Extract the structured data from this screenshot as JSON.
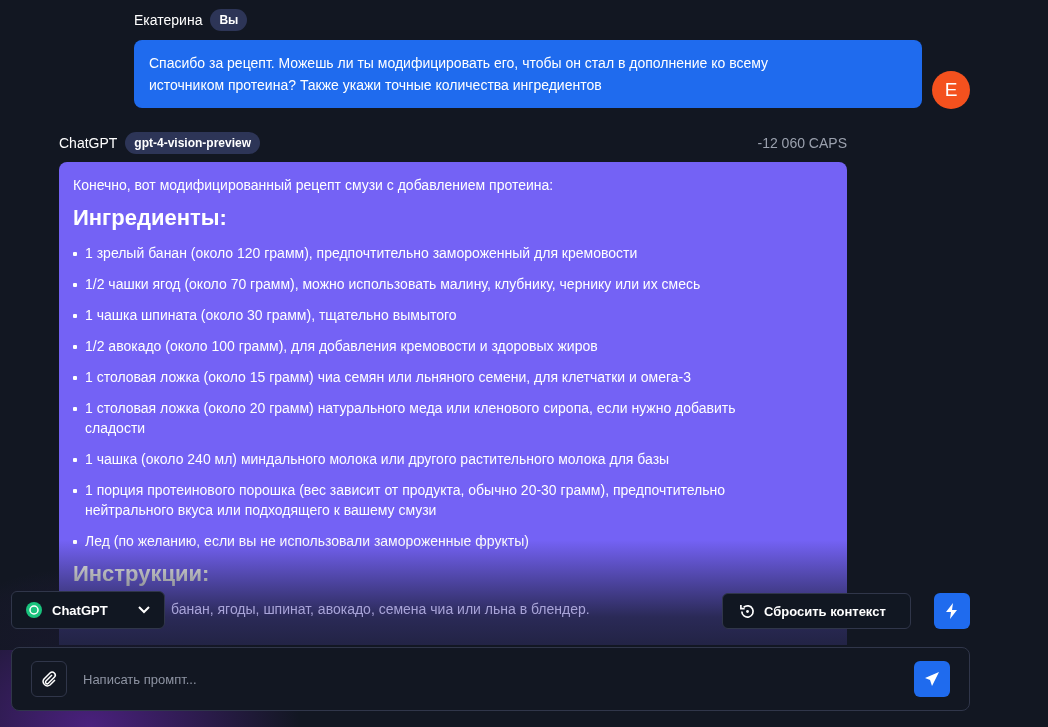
{
  "user_message": {
    "author": "Екатерина",
    "badge": "Вы",
    "text": "Спасибо за рецепт. Можешь ли ты модифицировать его, чтобы он стал в дополнение ко всему источником протеина? Также укажи точные количества ингредиентов",
    "avatar": "E"
  },
  "bot_message": {
    "author": "ChatGPT",
    "model": "gpt-4-vision-preview",
    "cost": "-12 060 CAPS",
    "intro": "Конечно, вот модифицированный рецепт смузи с добавлением протеина:",
    "ingredients_heading": "Ингредиенты:",
    "ingredients": [
      "1 зрелый банан (около 120 грамм), предпочтительно замороженный для кремовости",
      "1/2 чашки ягод (около 70 грамм), можно использовать малину, клубнику, чернику или их смесь",
      "1 чашка шпината (около 30 грамм), тщательно вымытого",
      "1/2 авокадо (около 100 грамм), для добавления кремовости и здоровых жиров",
      "1 столовая ложка (около 15 грамм) чиа семян или льняного семени, для клетчатки и омега-3",
      "1 столовая ложка (около 20 грамм) натурального меда или кленового сиропа, если нужно добавить сладости",
      "1 чашка (около 240 мл) миндального молока или другого растительного молока для базы",
      "1 порция протеинового порошка (вес зависит от продукта, обычно 20-30 грамм), предпочтительно нейтрального вкуса или подходящего к вашему смузи",
      "Лед (по желанию, если вы не использовали замороженные фрукты)"
    ],
    "instructions_heading": "Инструкции:",
    "instructions": [
      "банан, ягоды, шпинат, авокадо, семена чиа или льна в блендер."
    ]
  },
  "model_select": {
    "value": "ChatGPT"
  },
  "reset_button": {
    "label": "Сбросить контекст"
  },
  "prompt": {
    "placeholder": "Написать промпт..."
  }
}
